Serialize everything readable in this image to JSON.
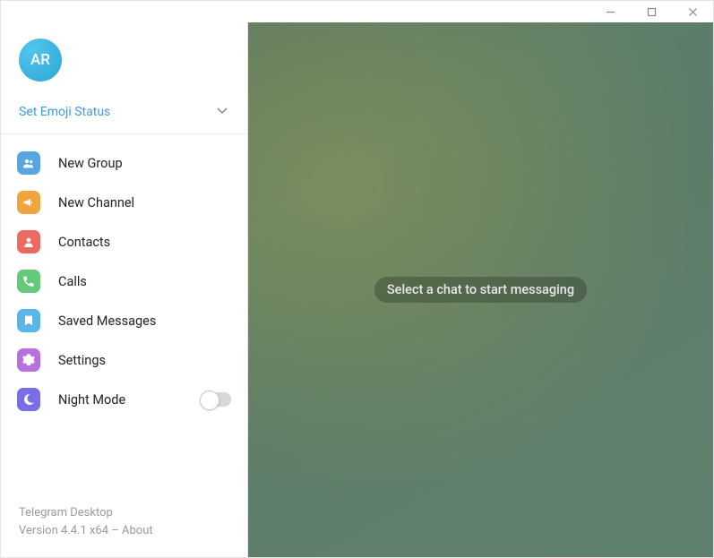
{
  "titlebar": {
    "minimize_icon": "minimize",
    "maximize_icon": "maximize",
    "close_icon": "close"
  },
  "profile": {
    "avatar_initials": "AR"
  },
  "emoji_status": {
    "label": "Set Emoji Status"
  },
  "menu": {
    "new_group": {
      "label": "New Group",
      "icon": "group",
      "color": "blue"
    },
    "new_channel": {
      "label": "New Channel",
      "icon": "megaphone",
      "color": "orange"
    },
    "contacts": {
      "label": "Contacts",
      "icon": "person",
      "color": "red"
    },
    "calls": {
      "label": "Calls",
      "icon": "phone",
      "color": "green"
    },
    "saved_messages": {
      "label": "Saved Messages",
      "icon": "bookmark",
      "color": "sky"
    },
    "settings": {
      "label": "Settings",
      "icon": "gear",
      "color": "violet1"
    },
    "night_mode": {
      "label": "Night Mode",
      "icon": "moon",
      "color": "violet2",
      "enabled": false
    }
  },
  "footer": {
    "app_name": "Telegram Desktop",
    "version_line": "Version 4.4.1 x64 – About"
  },
  "main": {
    "placeholder": "Select a chat to start messaging"
  }
}
